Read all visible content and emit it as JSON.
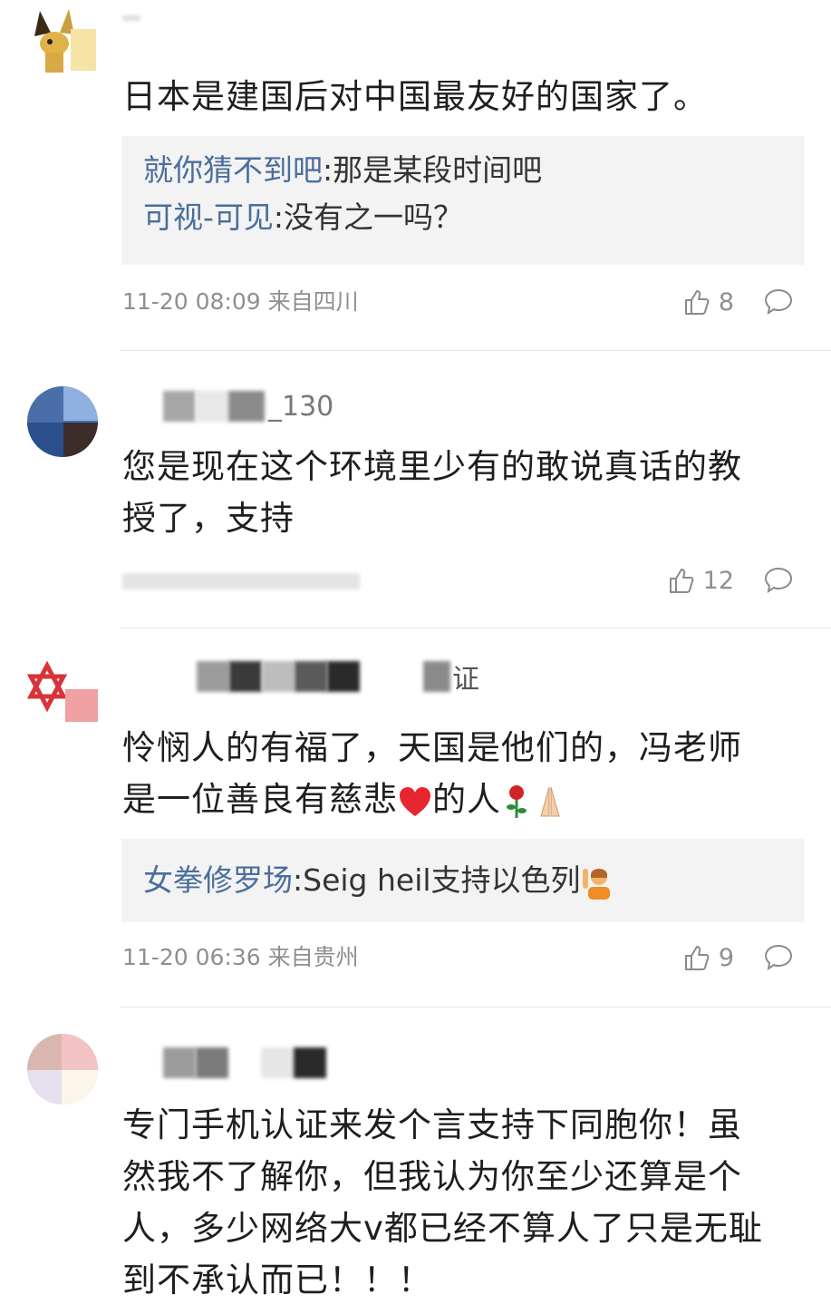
{
  "comments": [
    {
      "username_visible": "",
      "content": "日本是建国后对中国最友好的国家了。",
      "replies": [
        {
          "name": "就你猜不到吧",
          "text": ":那是某段时间吧"
        },
        {
          "name": "可视-可见",
          "text": ":没有之一吗？"
        }
      ],
      "meta": "11-20 08:09 来自四川",
      "likes": "8"
    },
    {
      "username_visible": "_130",
      "content_line1": "您是现在这个环境里少有的敢说真话的教",
      "content_line2": "授了，支持",
      "likes": "12"
    },
    {
      "username_visible": "证",
      "content_line1": "怜悯人的有福了，天国是他们的，冯老师",
      "content_line2": "是一位善良有慈悲",
      "content_line2_tail": "的人",
      "replies": [
        {
          "name": "女拳修罗场",
          "text": ":Seig heil支持以色列"
        }
      ],
      "meta": "11-20 06:36 来自贵州",
      "likes": "9"
    },
    {
      "content_line1": "专门手机认证来发个言支持下同胞你！虽",
      "content_line2": "然我不了解你，但我认为你至少还算是个",
      "content_line3": "人，多少网络大v都已经不算人了只是无耻",
      "content_line4": "到不承认而已！！！"
    }
  ],
  "icons": {
    "like": "thumbs-up-icon",
    "reply": "speech-bubble-icon"
  },
  "colors": {
    "username_link": "#4a6e9c",
    "meta_gray": "#8f8f8f",
    "reply_bg": "#f3f3f3"
  }
}
